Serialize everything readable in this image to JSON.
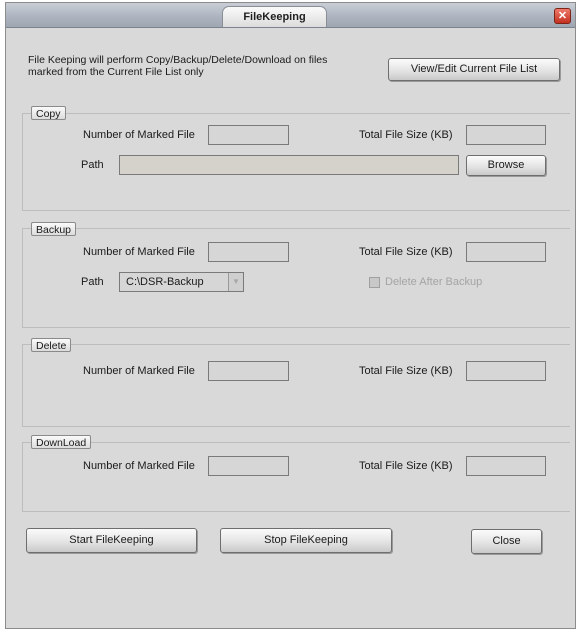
{
  "window": {
    "title": "FileKeeping",
    "close_glyph": "✕"
  },
  "info": {
    "line1": "File Keeping will perform Copy/Backup/Delete/Download on files",
    "line2": "marked from the Current File List only",
    "view_edit_button": "View/Edit Current File List"
  },
  "copy": {
    "legend": "Copy",
    "marked_label": "Number of Marked File",
    "size_label": "Total File Size (KB)",
    "marked_value": "",
    "size_value": "",
    "path_label": "Path",
    "path_value": "",
    "browse_button": "Browse"
  },
  "backup": {
    "legend": "Backup",
    "marked_label": "Number of Marked File",
    "size_label": "Total File Size (KB)",
    "marked_value": "",
    "size_value": "",
    "path_label": "Path",
    "path_value": "C:\\DSR-Backup",
    "delete_after_label": "Delete After Backup",
    "delete_after_checked": false
  },
  "delete": {
    "legend": "Delete",
    "marked_label": "Number of Marked File",
    "size_label": "Total File Size (KB)",
    "marked_value": "",
    "size_value": ""
  },
  "download": {
    "legend": "DownLoad",
    "marked_label": "Number of Marked File",
    "size_label": "Total File Size (KB)",
    "marked_value": "",
    "size_value": ""
  },
  "actions": {
    "start": "Start FileKeeping",
    "stop": "Stop FileKeeping",
    "close": "Close"
  },
  "icons": {
    "close": "close-icon",
    "dropdown": "chevron-down-icon"
  },
  "colors": {
    "window_bg": "#d9d9d9",
    "close_red": "#c3301f",
    "titlebar": "#aeb5c0"
  }
}
